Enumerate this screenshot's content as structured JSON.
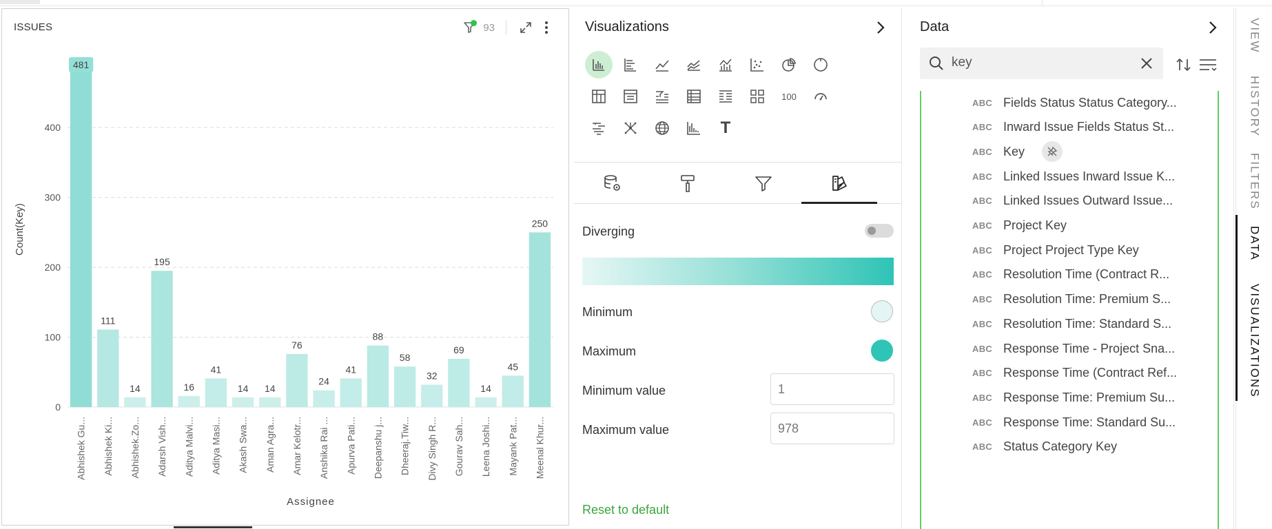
{
  "chart_panel": {
    "title": "ISSUES",
    "filter_count": "93"
  },
  "chart_data": {
    "type": "bar",
    "categories": [
      "Abhishek Gu...",
      "Abhishek Ki...",
      "Abhishek.Zo...",
      "Adarsh Vish...",
      "Aditya Malvi...",
      "Aditya Masi...",
      "Akash Swa...",
      "Aman Agra...",
      "Amar Kelotr...",
      "Anshika Rai ...",
      "Apurva Pati...",
      "Deepanshu j...",
      "Dheeraj.Tiw...",
      "Divy Singh R...",
      "Gourav Sah...",
      "Leena Joshi...",
      "Mayank Pat...",
      "Meenal Khur..."
    ],
    "values": [
      481,
      111,
      14,
      195,
      16,
      41,
      14,
      14,
      76,
      24,
      41,
      88,
      58,
      32,
      69,
      14,
      45,
      250
    ],
    "xlabel": "Assignee",
    "ylabel": "Count(Key)",
    "ylim": [
      0,
      481
    ],
    "yticks": [
      0,
      100,
      200,
      300,
      400
    ],
    "grid": true,
    "color_scale": {
      "min_value": 1,
      "max_value": 978,
      "min_color": "#e6f7f5",
      "max_color": "#2ec4b6"
    }
  },
  "visualizations": {
    "title": "Visualizations",
    "icons": [
      "bar-chart-icon",
      "horizontal-bar-chart-icon",
      "line-chart-icon",
      "area-line-chart-icon",
      "combo-chart-icon",
      "scatter-chart-icon",
      "pie-chart-icon",
      "donut-chart-icon",
      "pivot-table-icon",
      "table-plus-icon",
      "filter-table-icon",
      "table-icon",
      "list-table-icon",
      "tiles-icon",
      "number-kpi-icon",
      "gauge-icon",
      "funnel-text-icon",
      "network-icon",
      "globe-map-icon",
      "histogram-icon",
      "text-icon"
    ],
    "number_icon_label": "100",
    "text_icon_label": "T",
    "tabs": [
      "data-settings",
      "format-paint",
      "filter",
      "color-palette"
    ],
    "diverging_label": "Diverging",
    "minimum_label": "Minimum",
    "maximum_label": "Maximum",
    "min_color": "#e3f6f5",
    "max_color": "#2ec4b6",
    "minimum_value_label": "Minimum value",
    "minimum_value": "1",
    "maximum_value_label": "Maximum value",
    "maximum_value": "978",
    "reset_label": "Reset to default"
  },
  "data_panel": {
    "title": "Data",
    "search_value": "key",
    "type_tag": "ABC",
    "fields": [
      "Fields Status Status Category...",
      "Inward Issue Fields Status St...",
      "Key",
      "Linked Issues Inward Issue K...",
      "Linked Issues Outward Issue...",
      "Project Key",
      "Project Project Type Key",
      "Resolution Time (Contract R...",
      "Resolution Time: Premium S...",
      "Resolution Time: Standard S...",
      "Response Time - Project Sna...",
      "Response Time (Contract Ref...",
      "Response Time: Premium Su...",
      "Response Time: Standard Su...",
      "Status Category Key"
    ]
  },
  "side_tabs": {
    "view": "VIEW",
    "history": "HISTORY",
    "filters": "FILTERS",
    "data": "DATA",
    "visualizations": "VISUALIZATIONS"
  }
}
